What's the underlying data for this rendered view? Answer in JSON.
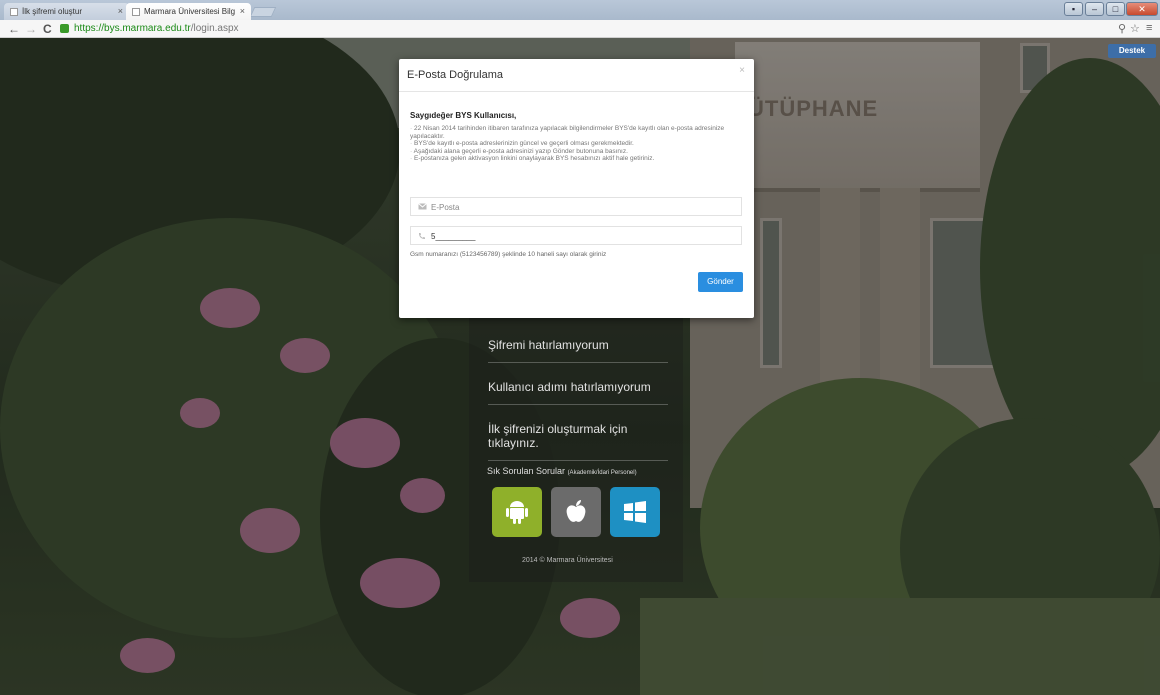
{
  "browser": {
    "tabs": [
      {
        "title": "İlk şifremi oluştur",
        "active": false
      },
      {
        "title": "Marmara Üniversitesi Bilg",
        "active": true
      }
    ],
    "url_scheme": "https://",
    "url_host": "bys.marmara.edu.tr",
    "url_path": "/login.aspx"
  },
  "page": {
    "support_button": "Destek",
    "building_sign": "ÜTÜPHANE",
    "links": [
      "Şifremi hatırlamıyorum",
      "Kullanıcı adımı hatırlamıyorum",
      "İlk şifrenizi oluşturmak için tıklayınız."
    ],
    "faq_label": "Sık Sorulan Sorular",
    "faq_sub": "(Akademik/İdari Personel)",
    "apps": [
      {
        "name": "android",
        "color": "#8fb02a"
      },
      {
        "name": "apple",
        "color": "#6b6b6b"
      },
      {
        "name": "windows",
        "color": "#1e90c3"
      }
    ],
    "copyright": "2014 © Marmara Üniversitesi"
  },
  "modal": {
    "title": "E-Posta Doğrulama",
    "close": "×",
    "greeting": "Saygıdeğer BYS Kullanıcısı,",
    "notes": [
      "22 Nisan 2014 tarihinden itibaren tarafınıza yapılacak bilgilendirmeler BYS'de kayıtlı olan e-posta adresinize yapılacaktır.",
      "BYS'de kayıtlı e-posta adreslerinizin güncel ve geçerli olması gerekmektedir.",
      "Aşağıdaki alana geçerli e-posta adresinizi yazıp Gönder butonuna basınız.",
      "E-postanıza gelen aktivasyon linkini onaylayarak BYS hesabınızı aktif hale getiriniz."
    ],
    "email_placeholder": "E-Posta",
    "phone_value": "5_________",
    "gsm_hint": "Gsm numaranızı (5123456789) şeklinde 10 haneli sayı olarak giriniz",
    "submit": "Gönder"
  },
  "colors": {
    "primary_button": "#2a8ee0",
    "support_button": "#3d6ea8"
  }
}
